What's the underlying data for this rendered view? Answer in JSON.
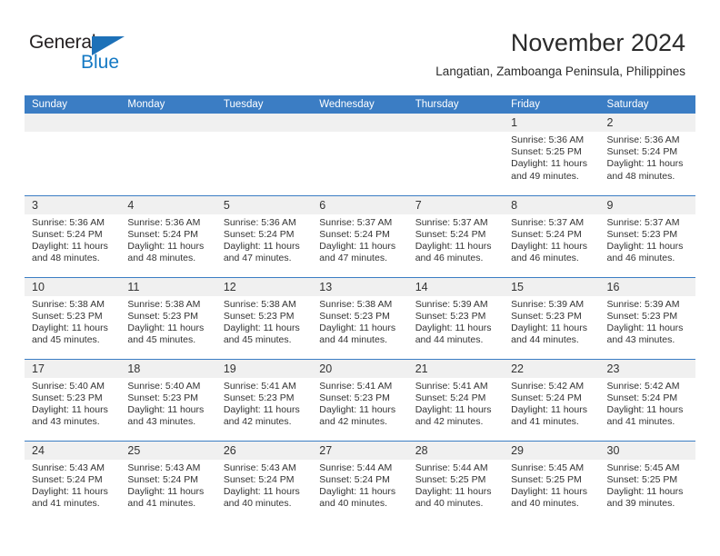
{
  "logo": {
    "word1": "General",
    "word2": "Blue",
    "triangle_color": "#1d71b8",
    "word2_color": "#1479c4"
  },
  "header": {
    "month_title": "November 2024",
    "location": "Langatian, Zamboanga Peninsula, Philippines"
  },
  "calendar": {
    "header_bg": "#3b7dc4",
    "daynum_bg": "#f0f0f0",
    "weekdays": [
      "Sunday",
      "Monday",
      "Tuesday",
      "Wednesday",
      "Thursday",
      "Friday",
      "Saturday"
    ],
    "weeks": [
      [
        {
          "day": "",
          "empty": true
        },
        {
          "day": "",
          "empty": true
        },
        {
          "day": "",
          "empty": true
        },
        {
          "day": "",
          "empty": true
        },
        {
          "day": "",
          "empty": true
        },
        {
          "day": "1",
          "sunrise": "Sunrise: 5:36 AM",
          "sunset": "Sunset: 5:25 PM",
          "daylight": "Daylight: 11 hours and 49 minutes."
        },
        {
          "day": "2",
          "sunrise": "Sunrise: 5:36 AM",
          "sunset": "Sunset: 5:24 PM",
          "daylight": "Daylight: 11 hours and 48 minutes."
        }
      ],
      [
        {
          "day": "3",
          "sunrise": "Sunrise: 5:36 AM",
          "sunset": "Sunset: 5:24 PM",
          "daylight": "Daylight: 11 hours and 48 minutes."
        },
        {
          "day": "4",
          "sunrise": "Sunrise: 5:36 AM",
          "sunset": "Sunset: 5:24 PM",
          "daylight": "Daylight: 11 hours and 48 minutes."
        },
        {
          "day": "5",
          "sunrise": "Sunrise: 5:36 AM",
          "sunset": "Sunset: 5:24 PM",
          "daylight": "Daylight: 11 hours and 47 minutes."
        },
        {
          "day": "6",
          "sunrise": "Sunrise: 5:37 AM",
          "sunset": "Sunset: 5:24 PM",
          "daylight": "Daylight: 11 hours and 47 minutes."
        },
        {
          "day": "7",
          "sunrise": "Sunrise: 5:37 AM",
          "sunset": "Sunset: 5:24 PM",
          "daylight": "Daylight: 11 hours and 46 minutes."
        },
        {
          "day": "8",
          "sunrise": "Sunrise: 5:37 AM",
          "sunset": "Sunset: 5:24 PM",
          "daylight": "Daylight: 11 hours and 46 minutes."
        },
        {
          "day": "9",
          "sunrise": "Sunrise: 5:37 AM",
          "sunset": "Sunset: 5:23 PM",
          "daylight": "Daylight: 11 hours and 46 minutes."
        }
      ],
      [
        {
          "day": "10",
          "sunrise": "Sunrise: 5:38 AM",
          "sunset": "Sunset: 5:23 PM",
          "daylight": "Daylight: 11 hours and 45 minutes."
        },
        {
          "day": "11",
          "sunrise": "Sunrise: 5:38 AM",
          "sunset": "Sunset: 5:23 PM",
          "daylight": "Daylight: 11 hours and 45 minutes."
        },
        {
          "day": "12",
          "sunrise": "Sunrise: 5:38 AM",
          "sunset": "Sunset: 5:23 PM",
          "daylight": "Daylight: 11 hours and 45 minutes."
        },
        {
          "day": "13",
          "sunrise": "Sunrise: 5:38 AM",
          "sunset": "Sunset: 5:23 PM",
          "daylight": "Daylight: 11 hours and 44 minutes."
        },
        {
          "day": "14",
          "sunrise": "Sunrise: 5:39 AM",
          "sunset": "Sunset: 5:23 PM",
          "daylight": "Daylight: 11 hours and 44 minutes."
        },
        {
          "day": "15",
          "sunrise": "Sunrise: 5:39 AM",
          "sunset": "Sunset: 5:23 PM",
          "daylight": "Daylight: 11 hours and 44 minutes."
        },
        {
          "day": "16",
          "sunrise": "Sunrise: 5:39 AM",
          "sunset": "Sunset: 5:23 PM",
          "daylight": "Daylight: 11 hours and 43 minutes."
        }
      ],
      [
        {
          "day": "17",
          "sunrise": "Sunrise: 5:40 AM",
          "sunset": "Sunset: 5:23 PM",
          "daylight": "Daylight: 11 hours and 43 minutes."
        },
        {
          "day": "18",
          "sunrise": "Sunrise: 5:40 AM",
          "sunset": "Sunset: 5:23 PM",
          "daylight": "Daylight: 11 hours and 43 minutes."
        },
        {
          "day": "19",
          "sunrise": "Sunrise: 5:41 AM",
          "sunset": "Sunset: 5:23 PM",
          "daylight": "Daylight: 11 hours and 42 minutes."
        },
        {
          "day": "20",
          "sunrise": "Sunrise: 5:41 AM",
          "sunset": "Sunset: 5:23 PM",
          "daylight": "Daylight: 11 hours and 42 minutes."
        },
        {
          "day": "21",
          "sunrise": "Sunrise: 5:41 AM",
          "sunset": "Sunset: 5:24 PM",
          "daylight": "Daylight: 11 hours and 42 minutes."
        },
        {
          "day": "22",
          "sunrise": "Sunrise: 5:42 AM",
          "sunset": "Sunset: 5:24 PM",
          "daylight": "Daylight: 11 hours and 41 minutes."
        },
        {
          "day": "23",
          "sunrise": "Sunrise: 5:42 AM",
          "sunset": "Sunset: 5:24 PM",
          "daylight": "Daylight: 11 hours and 41 minutes."
        }
      ],
      [
        {
          "day": "24",
          "sunrise": "Sunrise: 5:43 AM",
          "sunset": "Sunset: 5:24 PM",
          "daylight": "Daylight: 11 hours and 41 minutes."
        },
        {
          "day": "25",
          "sunrise": "Sunrise: 5:43 AM",
          "sunset": "Sunset: 5:24 PM",
          "daylight": "Daylight: 11 hours and 41 minutes."
        },
        {
          "day": "26",
          "sunrise": "Sunrise: 5:43 AM",
          "sunset": "Sunset: 5:24 PM",
          "daylight": "Daylight: 11 hours and 40 minutes."
        },
        {
          "day": "27",
          "sunrise": "Sunrise: 5:44 AM",
          "sunset": "Sunset: 5:24 PM",
          "daylight": "Daylight: 11 hours and 40 minutes."
        },
        {
          "day": "28",
          "sunrise": "Sunrise: 5:44 AM",
          "sunset": "Sunset: 5:25 PM",
          "daylight": "Daylight: 11 hours and 40 minutes."
        },
        {
          "day": "29",
          "sunrise": "Sunrise: 5:45 AM",
          "sunset": "Sunset: 5:25 PM",
          "daylight": "Daylight: 11 hours and 40 minutes."
        },
        {
          "day": "30",
          "sunrise": "Sunrise: 5:45 AM",
          "sunset": "Sunset: 5:25 PM",
          "daylight": "Daylight: 11 hours and 39 minutes."
        }
      ]
    ]
  }
}
